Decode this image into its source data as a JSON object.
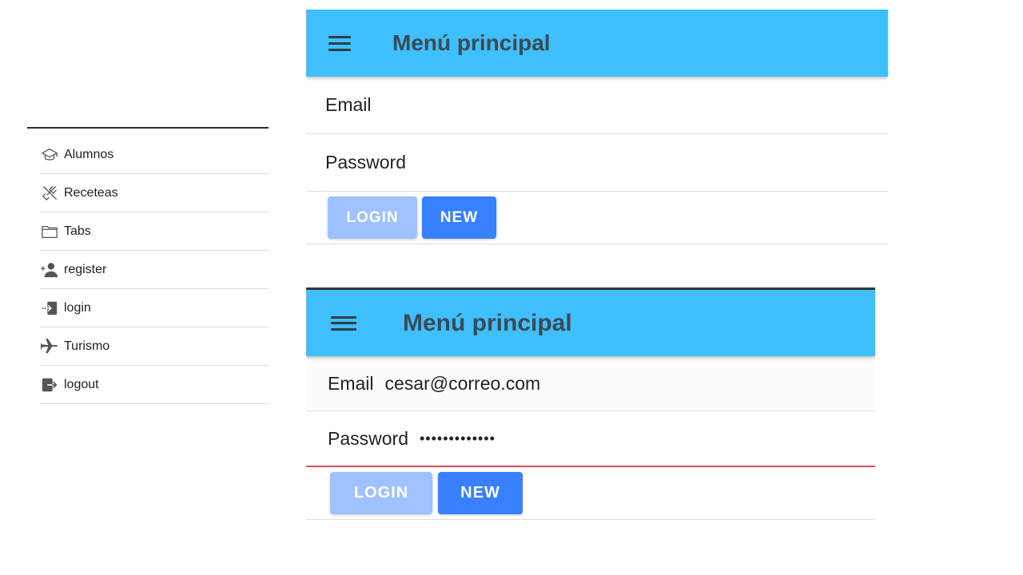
{
  "sidebar": {
    "items": [
      {
        "label": "Alumnos",
        "icon": "graduation-cap-icon"
      },
      {
        "label": "Receteas",
        "icon": "restaurant-icon"
      },
      {
        "label": "Tabs",
        "icon": "folder-icon"
      },
      {
        "label": "register",
        "icon": "person-add-icon"
      },
      {
        "label": "login",
        "icon": "log-in-icon"
      },
      {
        "label": "Turismo",
        "icon": "airplane-icon"
      },
      {
        "label": "logout",
        "icon": "log-out-icon"
      }
    ]
  },
  "screen_empty": {
    "title": "Menú principal",
    "email_label": "Email",
    "email_value": "",
    "password_label": "Password",
    "password_value": "",
    "login_label": "LOGIN",
    "new_label": "NEW"
  },
  "screen_filled": {
    "title": "Menú principal",
    "email_label": "Email",
    "email_value": "cesar@correo.com",
    "password_label": "Password",
    "password_value": "•••••••••••••",
    "login_label": "LOGIN",
    "new_label": "NEW"
  },
  "colors": {
    "toolbar": "#3fc0fd",
    "title_text": "#3b4a55",
    "login_disabled": "#9ec2ff",
    "new_button": "#3880ff",
    "invalid_underline": "#d74a5a"
  }
}
